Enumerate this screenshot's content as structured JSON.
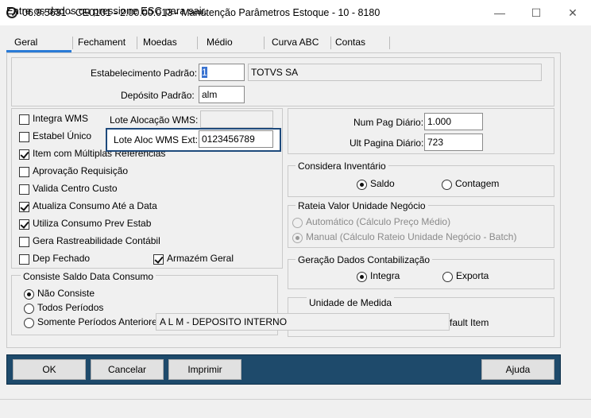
{
  "window": {
    "title": "06.9.5631 - CE0101 - 2.00.00.013 - Manutenção Parâmetros Estoque - 10 - 8180",
    "minimize": "—",
    "maximize": "☐",
    "close": "✕"
  },
  "tabs": [
    "Geral",
    "Fechamento",
    "Moedas",
    "Médio",
    "Curva ABC",
    "Contas"
  ],
  "tabs_display": [
    "Geral",
    "Fechament",
    "Moedas",
    "Médio",
    "Curva ABC",
    "Contas"
  ],
  "header": {
    "estab_label": "Estabelecimento Padrão:",
    "estab_value": "1",
    "estab_name": "TOTVS SA",
    "deposito_label": "Depósito Padrão:",
    "deposito_value": "alm"
  },
  "checks": [
    {
      "label": "Integra WMS",
      "checked": false
    },
    {
      "label": "Estabel Único",
      "checked": false
    },
    {
      "label": "Item com Múltiplas Referências",
      "checked": true
    },
    {
      "label": "Aprovação Requisição",
      "checked": false
    },
    {
      "label": "Valida Centro Custo",
      "checked": false
    },
    {
      "label": "Atualiza Consumo Até a Data",
      "checked": true
    },
    {
      "label": "Utiliza Consumo Prev Estab",
      "checked": true
    },
    {
      "label": "Gera Rastreabilidade Contábil",
      "checked": false
    },
    {
      "label": "Dep Fechado",
      "checked": false
    }
  ],
  "armazem": {
    "label": "Armazém Geral",
    "checked": true
  },
  "lote": {
    "alocacao_label": "Lote Alocação WMS:",
    "alocacao_value": "",
    "ext_label": "Lote Aloc WMS Ext:",
    "ext_value": "0123456789"
  },
  "paginas": {
    "num_pag_label": "Num Pag Diário:",
    "num_pag_value": "1.000",
    "ult_pag_label": "Ult Pagina Diário:",
    "ult_pag_value": "723"
  },
  "inventario": {
    "title": "Considera Inventário",
    "options": [
      "Saldo",
      "Contagem"
    ],
    "selected": 0
  },
  "rateia": {
    "title": "Rateia Valor Unidade Negócio",
    "options": [
      "Automático (Cálculo Preço Médio)",
      "Manual (Cálculo Rateio Unidade Negócio - Batch)"
    ],
    "selected": 1
  },
  "contabilizacao": {
    "title": "Geração Dados Contabilização",
    "options": [
      "Integra",
      "Exporta"
    ],
    "selected": 0
  },
  "unidade": {
    "title": "Unidade de Medida",
    "default_item": "fault Item"
  },
  "consiste": {
    "title": "Consiste Saldo Data Consumo",
    "options": [
      "Não Consiste",
      "Todos Períodos",
      "Somente Períodos Anteriores"
    ],
    "options_display": [
      "Não Consiste",
      "Todos Períodos",
      "Somente Períodos Anteriore"
    ],
    "selected": 0
  },
  "deposito_tooltip": "A L M - DEPOSITO INTERNO",
  "buttons": {
    "ok": "OK",
    "cancelar": "Cancelar",
    "imprimir": "Imprimir",
    "ajuda": "Ajuda"
  },
  "status": "Entre os dados ou pressione ESC para sair.",
  "colors": {
    "accent": "#2a7bd6",
    "bottom_bar": "#1e4a6b",
    "highlight_border": "#1e4a7c"
  }
}
